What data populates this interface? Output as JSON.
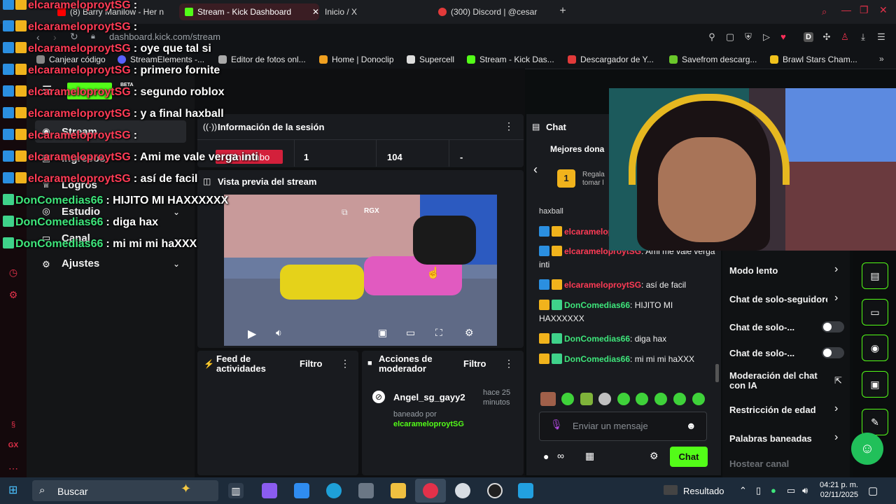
{
  "browser": {
    "tabs": [
      {
        "label": "(8) Barry Manilow - Her n",
        "active": false
      },
      {
        "label": "Stream - Kick Dashboard",
        "active": true
      },
      {
        "label": "Inicio / X",
        "active": false
      },
      {
        "label": "(300) Discord | @cesar",
        "active": false
      }
    ],
    "new_tab": "+",
    "url": "dashboard.kick.com/stream",
    "bookmarks": [
      "Canjear código",
      "StreamElements -...",
      "Editor de fotos onl...",
      "Home | Donoclip",
      "Supercell",
      "Stream - Kick Das...",
      "Descargador de Y...",
      "Savefrom descarg...",
      "Brawl Stars Cham..."
    ],
    "extension_letter": "D"
  },
  "sidebar": {
    "items": [
      {
        "label": "Stream",
        "icon": "broadcast-icon"
      },
      {
        "label": "Ingresos",
        "icon": "money-icon"
      },
      {
        "label": "Logros",
        "icon": "trophy-icon"
      },
      {
        "label": "Estudio",
        "icon": "studio-icon"
      },
      {
        "label": "Canal",
        "icon": "channel-icon"
      },
      {
        "label": "Ajustes",
        "icon": "gear-icon"
      }
    ],
    "logo_badge": "BETA"
  },
  "session": {
    "title": "Información de la sesión",
    "stats": [
      "Sin rumbo",
      "1",
      "104",
      "-"
    ]
  },
  "preview": {
    "title": "Vista previa del stream",
    "watermark": "RGX"
  },
  "feed": {
    "title": "Feed de actividades",
    "filter": "Filtro"
  },
  "mod_actions": {
    "title": "Acciones de moderador",
    "filter": "Filtro",
    "entry": {
      "user": "Angel_sg_gayy2",
      "time": "hace 25 minutos",
      "action": "baneado por",
      "by": "elcarameloproytSG"
    }
  },
  "chat": {
    "title": "Chat",
    "top_donors": "Mejores dona",
    "donor_rank": "1",
    "donor_text": "Regala tomar l",
    "cut_message": "haxball",
    "messages": [
      {
        "user": "elcarameloproytSG",
        "text": "",
        "badges": [
          "blue",
          "gold"
        ]
      },
      {
        "user": "elcarameloproytSG",
        "text": "Ami me vale verga inti",
        "badges": [
          "blue",
          "gold"
        ]
      },
      {
        "user": "elcarameloproytSG",
        "text": "así de facil",
        "badges": [
          "blue",
          "gold"
        ]
      },
      {
        "user": "DonComedias66",
        "text": "HIJITO MI HAXXXXXX",
        "badges": [
          "gold",
          "green"
        ]
      },
      {
        "user": "DonComedias66",
        "text": "diga hax",
        "badges": [
          "gold",
          "green"
        ]
      },
      {
        "user": "DonComedias66",
        "text": "mi mi mi haXXX",
        "badges": [
          "gold",
          "green"
        ]
      }
    ],
    "input_placeholder": "Enviar un mensaje",
    "send_label": "Chat"
  },
  "mod_menu": {
    "items": [
      {
        "label": "Modo lento",
        "control": "chevron"
      },
      {
        "label": "Chat de solo-seguidores",
        "control": "chevron"
      },
      {
        "label": "Chat de solo-...",
        "control": "toggle"
      },
      {
        "label": "Chat de solo-...",
        "control": "toggle"
      },
      {
        "label": "Moderación del chat con IA",
        "control": "external"
      },
      {
        "label": "Restricción de edad",
        "control": "chevron"
      },
      {
        "label": "Palabras baneadas",
        "control": "chevron"
      },
      {
        "label": "Hostear canal",
        "control": "none"
      }
    ]
  },
  "overlay_chat": [
    {
      "user": "elcarameloproytSG",
      "text": ":",
      "color": "red"
    },
    {
      "user": "elcarameloproytSG",
      "text": ":",
      "color": "red"
    },
    {
      "user": "elcarameloproytSG",
      "text": ": oye que tal si",
      "color": "red"
    },
    {
      "user": "elcarameloproytSG",
      "text": ": primero fornite",
      "color": "red"
    },
    {
      "user": "elcarameloproytSG",
      "text": ": segundo roblox",
      "color": "red"
    },
    {
      "user": "elcarameloproytSG",
      "text": ": y a final haxball",
      "color": "red"
    },
    {
      "user": "elcarameloproytSG",
      "text": ":",
      "color": "red"
    },
    {
      "user": "elcarameloproytSG",
      "text": ": Ami me vale verga inti",
      "color": "red"
    },
    {
      "user": "elcarameloproytSG",
      "text": ": así de facil",
      "color": "red"
    },
    {
      "user": "DonComedias66",
      "text": ": HIJITO MI HAXXXXXX",
      "color": "green"
    },
    {
      "user": "DonComedias66",
      "text": ": diga hax",
      "color": "green"
    },
    {
      "user": "DonComedias66",
      "text": ": mi mi mi haXXX",
      "color": "green"
    }
  ],
  "taskbar": {
    "search_label": "Buscar",
    "news": "Resultado",
    "time": "04:21 p. m.",
    "date": "02/11/2025"
  },
  "colors": {
    "kick_green": "#53fc18",
    "user_red": "#ff3b55",
    "user_green": "#3ee67b"
  }
}
